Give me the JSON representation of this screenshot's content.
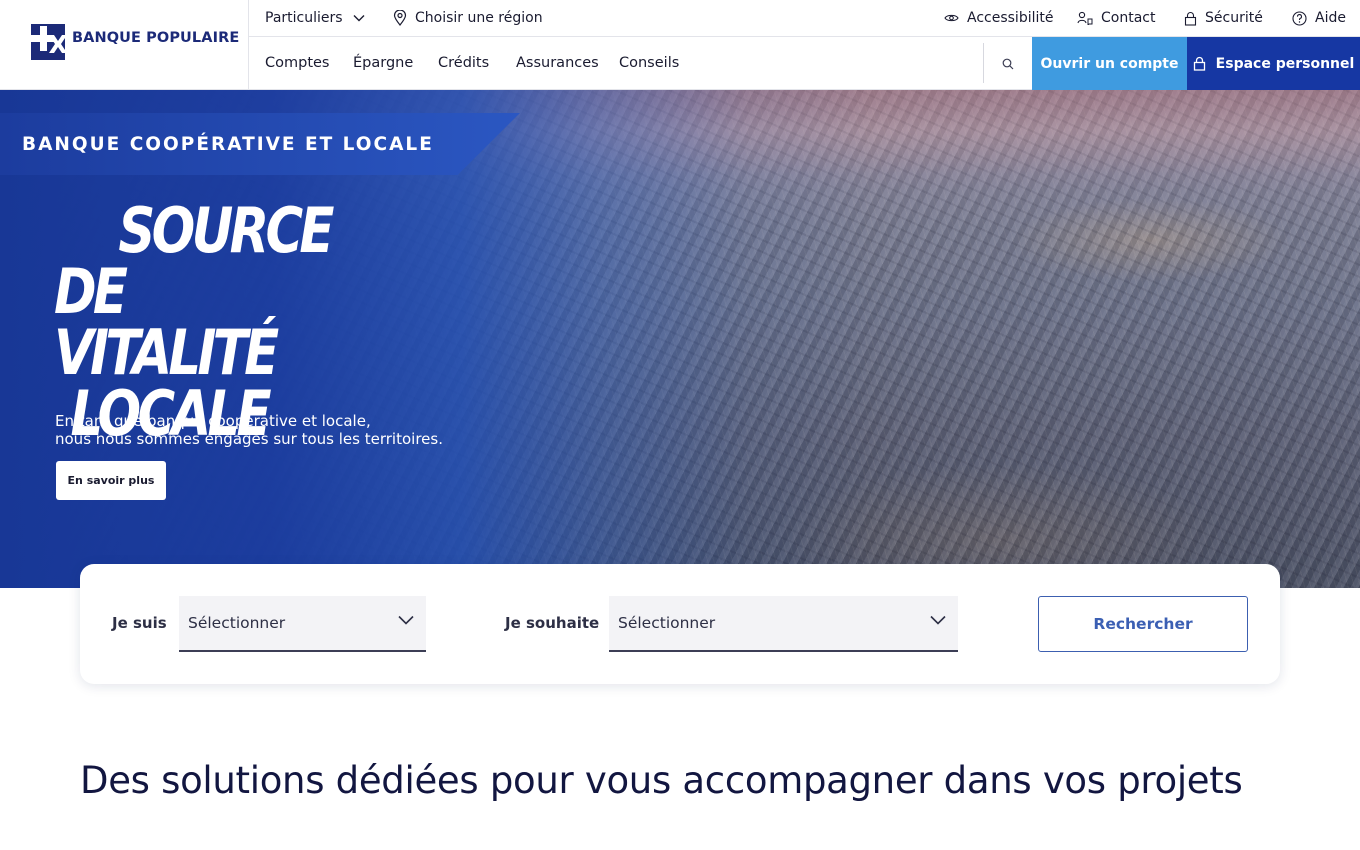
{
  "brand": {
    "name": "BANQUE POPULAIRE",
    "color": "#1c2a78"
  },
  "topbar": {
    "segment": "Particuliers",
    "region": "Choisir une région",
    "accessibility": "Accessibilité",
    "contact": "Contact",
    "security": "Sécurité",
    "help": "Aide"
  },
  "nav": {
    "items": [
      "Comptes",
      "Épargne",
      "Crédits",
      "Assurances",
      "Conseils"
    ],
    "open_account": "Ouvrir un compte",
    "personal_space": "Espace personnel",
    "open_account_color": "#3f9be0",
    "personal_space_color": "#1637a3"
  },
  "hero": {
    "tagline": "BANQUE COOPÉRATIVE ET LOCALE",
    "title_lines": [
      "SOURCE",
      "DE VITALITÉ",
      "LOCALE"
    ],
    "description_lines": [
      "En tant que banque coopérative et locale,",
      "nous nous sommes engagés sur tous les territoires."
    ],
    "cta": "En savoir plus"
  },
  "search": {
    "who_label": "Je suis",
    "who_value": "Sélectionner",
    "wish_label": "Je souhaite",
    "wish_value": "Sélectionner",
    "submit": "Rechercher"
  },
  "section": {
    "title": "Des solutions dédiées pour vous accompagner dans vos projets"
  },
  "icons": {
    "segment": "chevron-down-icon",
    "region": "location-pin-icon",
    "accessibility": "eye-icon",
    "contact": "person-contact-icon",
    "security": "lock-icon",
    "help": "question-circle-icon",
    "search": "search-icon",
    "personal_space": "lock-icon"
  }
}
